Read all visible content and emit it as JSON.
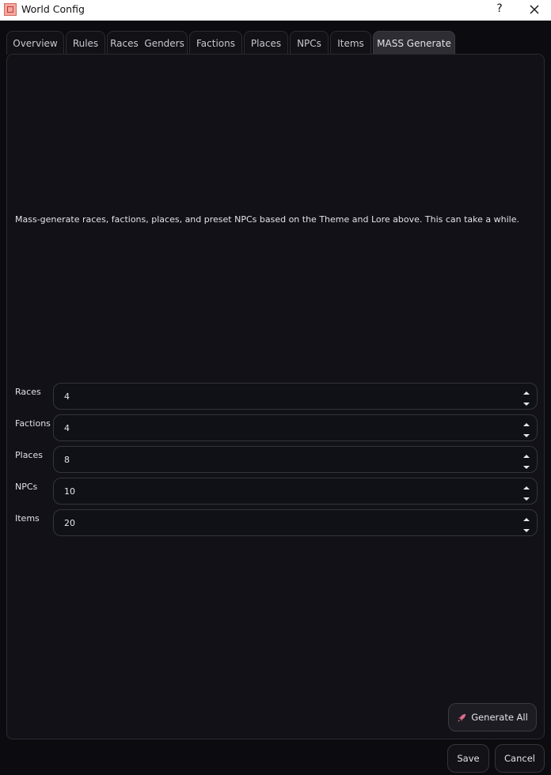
{
  "window": {
    "title": "World Config",
    "help_glyph": "?"
  },
  "tabs": [
    {
      "label": "Overview"
    },
    {
      "label": "Rules"
    },
    {
      "label": "Races  Genders"
    },
    {
      "label": "Factions"
    },
    {
      "label": "Places"
    },
    {
      "label": "NPCs"
    },
    {
      "label": "Items"
    },
    {
      "label": "MASS Generate",
      "active": true
    }
  ],
  "mass_generate": {
    "description": "Mass-generate races, factions, places, and preset NPCs based on the Theme and Lore above. This can take a while.",
    "fields": [
      {
        "label": "Races",
        "value": "4"
      },
      {
        "label": "Factions",
        "value": "4"
      },
      {
        "label": "Places",
        "value": "8"
      },
      {
        "label": "NPCs",
        "value": "10"
      },
      {
        "label": "Items",
        "value": "20"
      }
    ],
    "generate_button": "Generate All"
  },
  "footer": {
    "save_label": "Save",
    "cancel_label": "Cancel"
  },
  "colors": {
    "background": "#0c0c10",
    "panel": "#111117",
    "active_tab": "#2d2d33",
    "rocket": "#e06a8a"
  },
  "icons": {
    "app": "app-icon",
    "help": "help-icon",
    "close": "close-icon",
    "spin_up": "chevron-up-icon",
    "spin_down": "chevron-down-icon",
    "generate": "rocket-icon"
  }
}
